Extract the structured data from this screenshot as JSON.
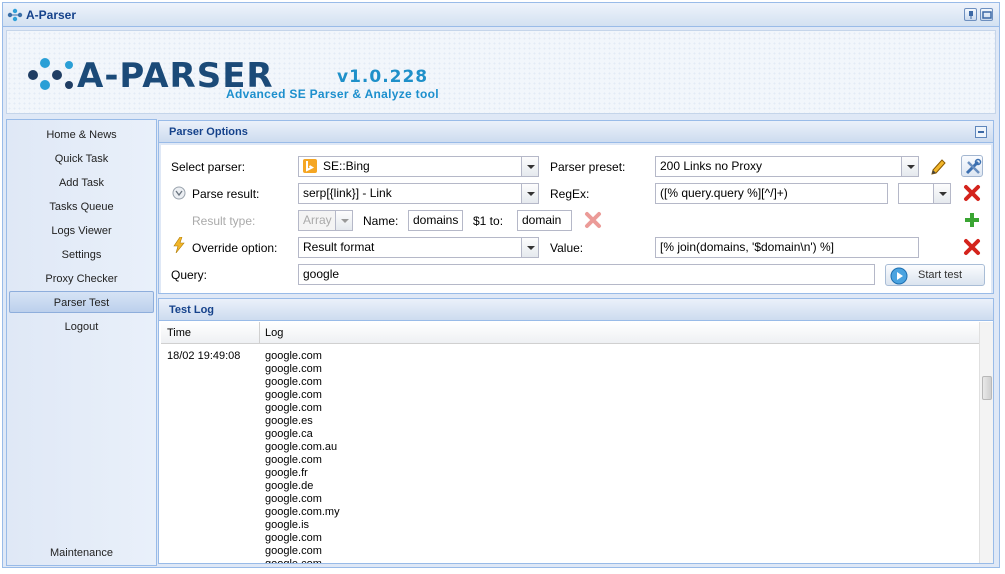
{
  "window": {
    "title": "A-Parser"
  },
  "header": {
    "logo_text": "A-PARSER",
    "version": "v1.0.228",
    "subtitle": "Advanced SE Parser & Analyze tool"
  },
  "sidebar": {
    "items": [
      {
        "label": "Home & News"
      },
      {
        "label": "Quick Task"
      },
      {
        "label": "Add Task"
      },
      {
        "label": "Tasks Queue"
      },
      {
        "label": "Logs Viewer"
      },
      {
        "label": "Settings"
      },
      {
        "label": "Proxy Checker"
      },
      {
        "label": "Parser Test",
        "active": true
      },
      {
        "label": "Logout"
      }
    ],
    "footer_item": "Maintenance"
  },
  "options": {
    "title": "Parser Options",
    "select_parser_label": "Select parser:",
    "select_parser_value": "SE::Bing",
    "parser_preset_label": "Parser preset:",
    "parser_preset_value": "200 Links no Proxy",
    "parse_result_label": "Parse result:",
    "parse_result_value": "serp[{link}] - Link",
    "regex_label": "RegEx:",
    "regex_value": "([% query.query %][^/]+)",
    "regex_flags_value": "",
    "result_type_label": "Result type:",
    "result_type_value": "Array",
    "name_label": "Name:",
    "name_value": "domains",
    "dollar1_label": "$1 to:",
    "dollar1_value": "domain",
    "override_label": "Override option:",
    "override_value": "Result format",
    "value_label": "Value:",
    "value_value": "[% join(domains, '$domain\\n') %]",
    "query_label": "Query:",
    "query_value": "google",
    "start_button": "Start test"
  },
  "testlog": {
    "title": "Test Log",
    "col_time": "Time",
    "col_log": "Log",
    "time_value": "18/02 19:49:08",
    "lines": [
      "google.com",
      "google.com",
      "google.com",
      "google.com",
      "google.com",
      "google.es",
      "google.ca",
      "google.com.au",
      "google.com",
      "google.fr",
      "google.de",
      "google.com",
      "google.com.my",
      "google.is",
      "google.com",
      "google.com",
      "google.com"
    ]
  },
  "colors": {
    "accent": "#15428b",
    "logo_blue": "#1c8fcd",
    "panel_border": "#99bbe8"
  }
}
